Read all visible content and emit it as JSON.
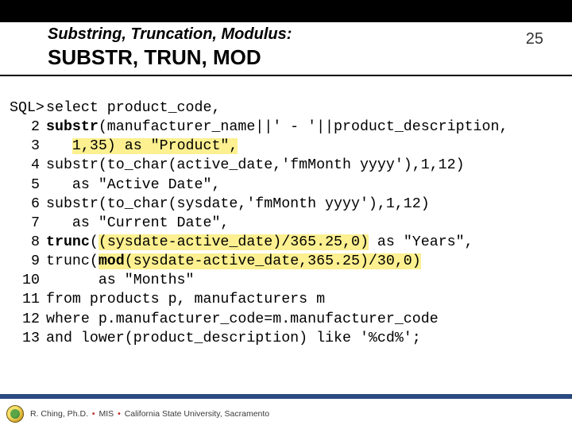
{
  "header": {
    "subtitle": "Substring, Truncation, Modulus:",
    "title": "SUBSTR, TRUN, MOD",
    "page_number": "25"
  },
  "code": {
    "lines": [
      {
        "num": "SQL>",
        "segs": [
          {
            "t": "select product_code,"
          }
        ]
      },
      {
        "num": "2",
        "segs": [
          {
            "t": "substr",
            "b": true
          },
          {
            "t": "(manufacturer_name||' - '||product_description,"
          }
        ]
      },
      {
        "num": "3",
        "segs": [
          {
            "t": "   "
          },
          {
            "t": "1,35) as \"Product\",",
            "hl": true
          }
        ]
      },
      {
        "num": "4",
        "segs": [
          {
            "t": "substr(to_char(active_date,'fmMonth yyyy'),1,12)"
          }
        ]
      },
      {
        "num": "5",
        "segs": [
          {
            "t": "   as \"Active Date\","
          }
        ]
      },
      {
        "num": "6",
        "segs": [
          {
            "t": "substr(to_char(sysdate,'fmMonth yyyy'),1,12)"
          }
        ]
      },
      {
        "num": "7",
        "segs": [
          {
            "t": "   as \"Current Date\","
          }
        ]
      },
      {
        "num": "8",
        "segs": [
          {
            "t": "trunc",
            "b": true
          },
          {
            "t": "("
          },
          {
            "t": "(sysdate-active_date)/365.25,0)",
            "hl": true
          },
          {
            "t": " as \"Years\","
          }
        ]
      },
      {
        "num": "9",
        "segs": [
          {
            "t": "trunc("
          },
          {
            "t": "mod",
            "b": true,
            "hl": true
          },
          {
            "t": "(sysdate-active_date,365.25)/30,0)",
            "hl": true
          }
        ]
      },
      {
        "num": "10",
        "segs": [
          {
            "t": "      as \"Months\""
          }
        ]
      },
      {
        "num": "11",
        "segs": [
          {
            "t": "from products p, manufacturers m"
          }
        ]
      },
      {
        "num": "12",
        "segs": [
          {
            "t": "where p.manufacturer_code=m.manufacturer_code"
          }
        ]
      },
      {
        "num": "13",
        "segs": [
          {
            "t": "and lower(product_description) like '%cd%';"
          }
        ]
      }
    ]
  },
  "footer": {
    "author": "R. Ching, Ph.D.",
    "dept": "MIS",
    "org": "California State University, Sacramento",
    "bullet": "•"
  }
}
